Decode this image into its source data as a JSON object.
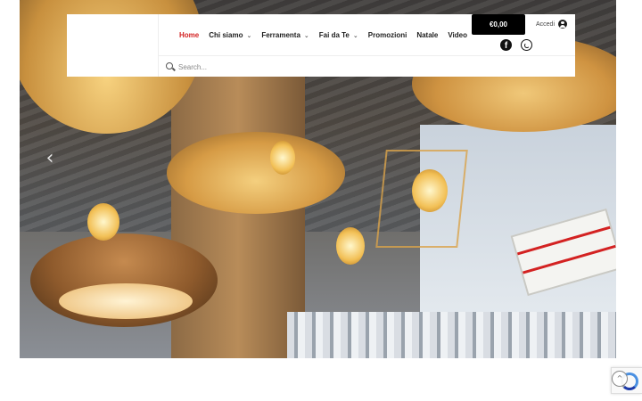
{
  "nav": {
    "items": [
      {
        "label": "Home",
        "active": true,
        "has_dropdown": false
      },
      {
        "label": "Chi siamo",
        "active": false,
        "has_dropdown": true
      },
      {
        "label": "Ferramenta",
        "active": false,
        "has_dropdown": true
      },
      {
        "label": "Fai da Te",
        "active": false,
        "has_dropdown": true
      },
      {
        "label": "Promozioni",
        "active": false,
        "has_dropdown": false
      },
      {
        "label": "Natale",
        "active": false,
        "has_dropdown": false
      },
      {
        "label": "Video",
        "active": false,
        "has_dropdown": false
      }
    ],
    "dropdown_glyph": "⌄"
  },
  "cart": {
    "total": "€0,00"
  },
  "account": {
    "login_label": "Accedi"
  },
  "social": {
    "facebook_glyph": "f",
    "icons": [
      "facebook-icon",
      "whatsapp-icon"
    ]
  },
  "search": {
    "placeholder": "Search..."
  },
  "slider": {
    "prev_glyph": "‹",
    "next_glyph": "›"
  },
  "scroll_top": {
    "glyph": "^"
  },
  "colors": {
    "accent": "#d32222",
    "cart_bg": "#000000",
    "header_bg": "#ffffff"
  }
}
